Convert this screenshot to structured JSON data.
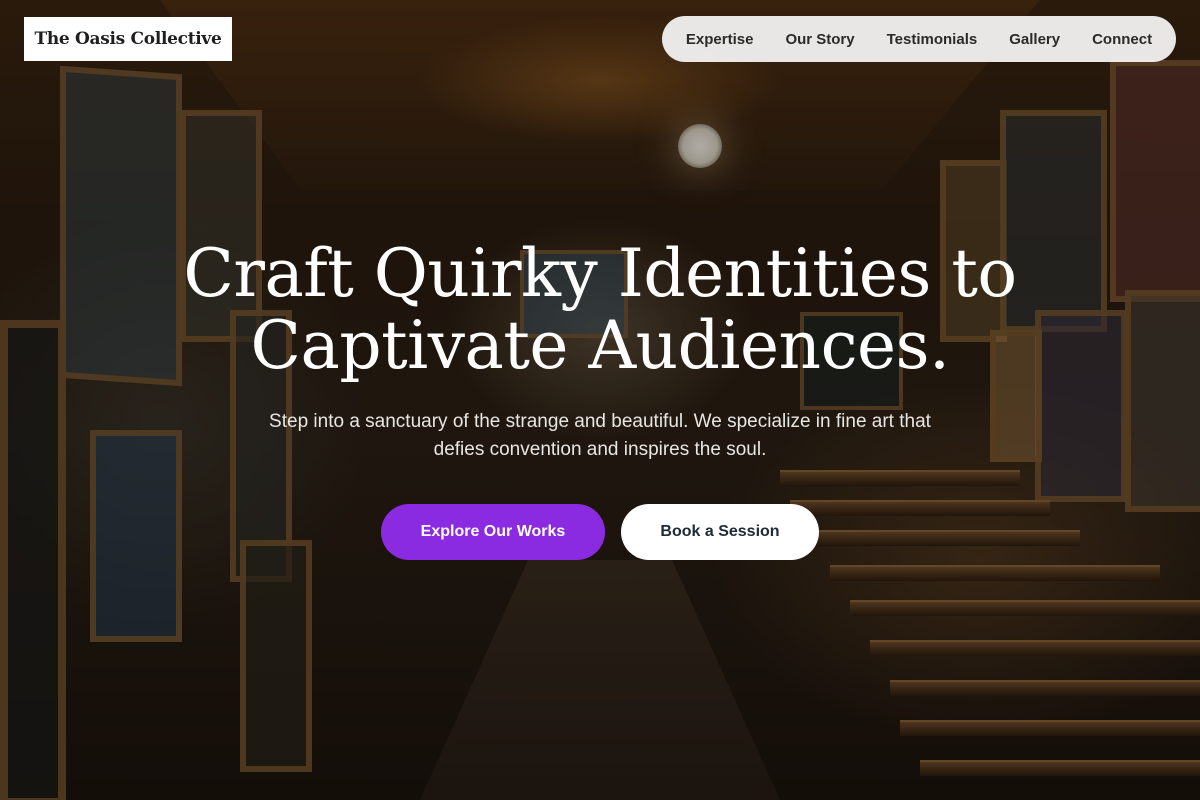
{
  "brand": {
    "name": "The Oasis Collective"
  },
  "nav": {
    "items": [
      {
        "label": "Expertise"
      },
      {
        "label": "Our Story"
      },
      {
        "label": "Testimonials"
      },
      {
        "label": "Gallery"
      },
      {
        "label": "Connect"
      }
    ]
  },
  "hero": {
    "headline_line1": "Craft Quirky Identities to",
    "headline_line2": "Captivate Audiences.",
    "subtext": "Step into a sanctuary of the strange and beautiful. We specialize in fine art that defies convention and inspires the soul.",
    "primary_cta": "Explore Our Works",
    "secondary_cta": "Book a Session"
  },
  "colors": {
    "accent": "#8a2be2",
    "button_secondary_bg": "#ffffff",
    "nav_bg": "#f2f2f2",
    "text_light": "#ffffff"
  }
}
